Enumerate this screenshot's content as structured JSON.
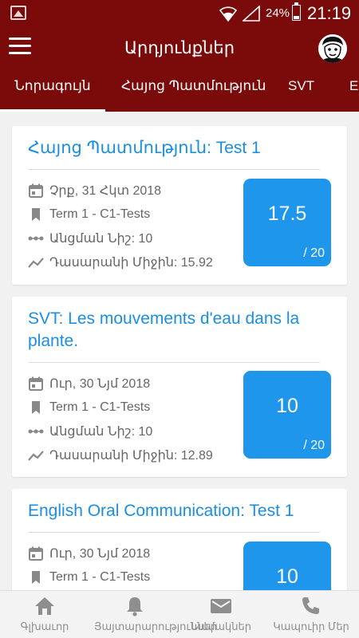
{
  "status_bar": {
    "battery": "24%",
    "time": "21:19"
  },
  "app_bar": {
    "title": "Արդյունքներ"
  },
  "tabs": [
    {
      "label": "Նորագույն",
      "active": true
    },
    {
      "label": "Հայոց Պատմություն",
      "active": false
    },
    {
      "label": "SVT",
      "active": false
    },
    {
      "label": "E",
      "active": false
    }
  ],
  "results": [
    {
      "title": "Հայոց Պատմություն: Test 1",
      "date": "Չրք, 31 Հկտ 2018",
      "term": "Term 1 - C1-Tests",
      "pass_mark": "Անցման Նիշ: 10",
      "class_average": "Դասարանի Միջին: 15.92",
      "score": "17.5",
      "max": "/ 20"
    },
    {
      "title": "SVT: Les mouvements d'eau dans la plante.",
      "date": "Ուր, 30 Նյմ 2018",
      "term": "Term 1 - C1-Tests",
      "pass_mark": "Անցման Նիշ: 10",
      "class_average": "Դասարանի Միջին: 12.89",
      "score": "10",
      "max": "/ 20"
    },
    {
      "title": "English Oral Communication: Test 1",
      "date": "Ուր, 30 Նյմ 2018",
      "term": "Term 1 - C1-Tests",
      "score": "10"
    }
  ],
  "bottom_nav": [
    {
      "label": "Գլխաւոր",
      "icon": "home-icon"
    },
    {
      "label": "Յայտարարություններ",
      "icon": "bell-icon"
    },
    {
      "label": "Նամակներ",
      "icon": "mail-icon"
    },
    {
      "label": "Կապուիր Մեր",
      "icon": "phone-icon"
    }
  ],
  "colors": {
    "brand": "#7b0a0a",
    "accent": "#1e96eb",
    "link": "#1a8ee0"
  }
}
